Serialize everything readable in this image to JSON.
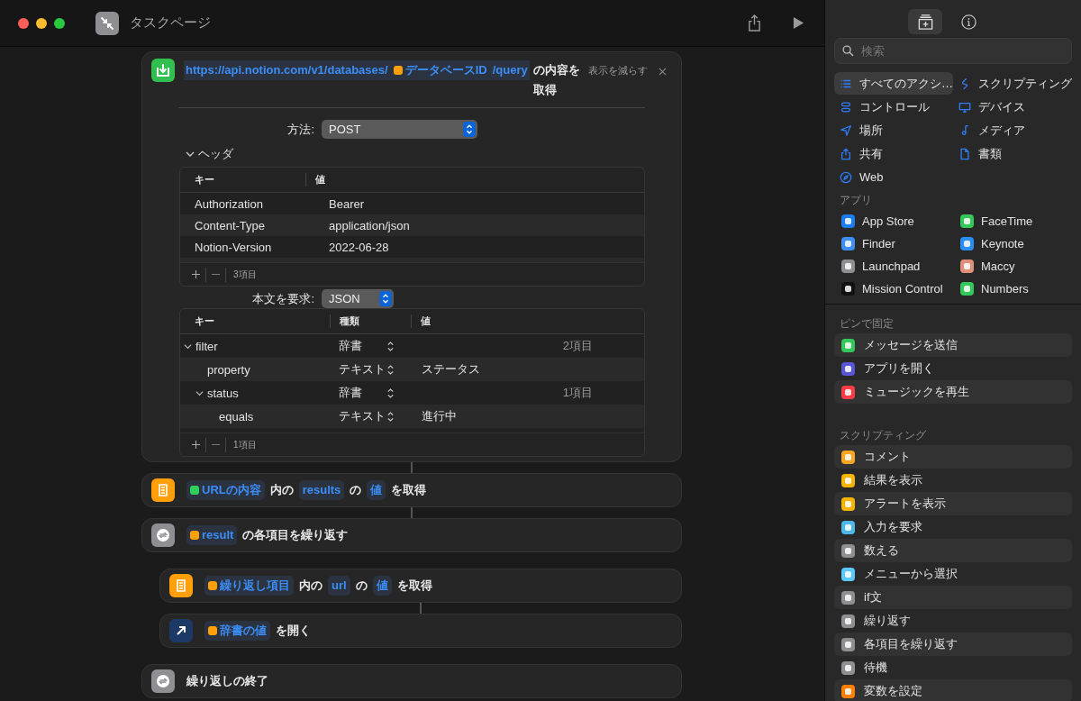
{
  "window": {
    "title": "タスクページ"
  },
  "actions": [
    {
      "kind": "get_contents",
      "tokens": [
        {
          "kind": "url",
          "text": "https://api.notion.com/v1/databases/"
        },
        {
          "kind": "variable",
          "text": "データベースID",
          "color": "#ff9f0a"
        },
        {
          "kind": "url",
          "text": "/query"
        },
        {
          "kind": "text",
          "text": "の内容を取得"
        }
      ],
      "collapse_button": "表示を減らす",
      "method": {
        "label": "方法:",
        "value": "POST"
      },
      "headers": {
        "label": "ヘッダ",
        "expanded": true,
        "columns": [
          "キー",
          "値"
        ],
        "rows": [
          {
            "key": "Authorization",
            "value": "Bearer"
          },
          {
            "key": "Content-Type",
            "value": "application/json"
          },
          {
            "key": "Notion-Version",
            "value": "2022-06-28"
          }
        ],
        "count": "3項目"
      },
      "body": {
        "label": "本文を要求:",
        "value": "JSON",
        "columns": [
          "キー",
          "種類",
          "値"
        ],
        "rows": [
          {
            "key": "filter",
            "type": "辞書",
            "count": "2項目",
            "expanded": true,
            "children": [
              {
                "key": "property",
                "type": "テキスト",
                "value": "ステータス"
              },
              {
                "key": "status",
                "type": "辞書",
                "count": "1項目",
                "expanded": true,
                "children": [
                  {
                    "key": "equals",
                    "type": "テキスト",
                    "value": "進行中"
                  }
                ]
              }
            ]
          }
        ],
        "count": "1項目"
      }
    },
    {
      "kind": "get_value",
      "tokens": [
        {
          "kind": "variable",
          "text": "URLの内容",
          "color": "#30d158"
        },
        {
          "kind": "text",
          "text": "内の"
        },
        {
          "kind": "param",
          "text": "results"
        },
        {
          "kind": "text",
          "text": "の"
        },
        {
          "kind": "param",
          "text": "値"
        },
        {
          "kind": "text",
          "text": "を取得"
        }
      ]
    },
    {
      "kind": "repeat_each",
      "tokens": [
        {
          "kind": "variable",
          "text": "result",
          "color": "#ff9f0a"
        },
        {
          "kind": "text",
          "text": "の各項目を繰り返す"
        }
      ],
      "children": [
        {
          "kind": "get_value",
          "tokens": [
            {
              "kind": "variable",
              "text": "繰り返し項目",
              "color": "#ff9f0a"
            },
            {
              "kind": "text",
              "text": "内の"
            },
            {
              "kind": "param",
              "text": "url"
            },
            {
              "kind": "text",
              "text": "の"
            },
            {
              "kind": "param",
              "text": "値"
            },
            {
              "kind": "text",
              "text": "を取得"
            }
          ]
        },
        {
          "kind": "open_url",
          "tokens": [
            {
              "kind": "variable",
              "text": "辞書の値",
              "color": "#ff9f0a"
            },
            {
              "kind": "text",
              "text": "を開く"
            }
          ]
        }
      ]
    },
    {
      "kind": "end_repeat",
      "tokens": [
        {
          "kind": "text",
          "text": "繰り返しの終了"
        }
      ]
    }
  ],
  "sidebar": {
    "panel_tabs": [
      {
        "selected": true
      },
      {
        "selected": false
      }
    ],
    "search": {
      "placeholder": "検索"
    },
    "categories": [
      {
        "label": "すべてのアクシ…",
        "selected": true
      },
      {
        "label": "スクリプティング",
        "selected": false
      },
      {
        "label": "コントロール",
        "selected": false
      },
      {
        "label": "デバイス",
        "selected": false
      },
      {
        "label": "場所",
        "selected": false
      },
      {
        "label": "メディア",
        "selected": false
      },
      {
        "label": "共有",
        "selected": false
      },
      {
        "label": "書類",
        "selected": false
      },
      {
        "label": "Web",
        "selected": false
      }
    ],
    "apps": {
      "title": "アプリ",
      "items": [
        {
          "name": "App Store",
          "color": "#1c7cf4"
        },
        {
          "name": "FaceTime",
          "color": "#34c759"
        },
        {
          "name": "Finder",
          "color": "#3d8ff5"
        },
        {
          "name": "Keynote",
          "color": "#2a8ef0"
        },
        {
          "name": "Launchpad",
          "color": "#8e8e93"
        },
        {
          "name": "Maccy",
          "color": "#e0907a"
        },
        {
          "name": "Mission Control",
          "color": "#111111"
        },
        {
          "name": "Numbers",
          "color": "#34c759"
        }
      ]
    },
    "pinned": {
      "title": "ピンで固定",
      "items": [
        {
          "name": "メッセージを送信",
          "color": "#34c759"
        },
        {
          "name": "アプリを開く",
          "color": "#5856d6"
        },
        {
          "name": "ミュージックを再生",
          "color": "#fc3c44"
        }
      ]
    },
    "scripting": {
      "title": "スクリプティング",
      "items": [
        {
          "name": "コメント",
          "color": "#f5a623"
        },
        {
          "name": "結果を表示",
          "color": "#f5b400"
        },
        {
          "name": "アラートを表示",
          "color": "#f5b400"
        },
        {
          "name": "入力を要求",
          "color": "#4cb8e8"
        },
        {
          "name": "数える",
          "color": "#8e8e93"
        },
        {
          "name": "メニューから選択",
          "color": "#5ac8fa"
        },
        {
          "name": "if文",
          "color": "#8e8e93"
        },
        {
          "name": "繰り返す",
          "color": "#8e8e93"
        },
        {
          "name": "各項目を繰り返す",
          "color": "#8e8e93"
        },
        {
          "name": "待機",
          "color": "#8e8e93"
        },
        {
          "name": "変数を設定",
          "color": "#ff7f00"
        }
      ]
    }
  }
}
